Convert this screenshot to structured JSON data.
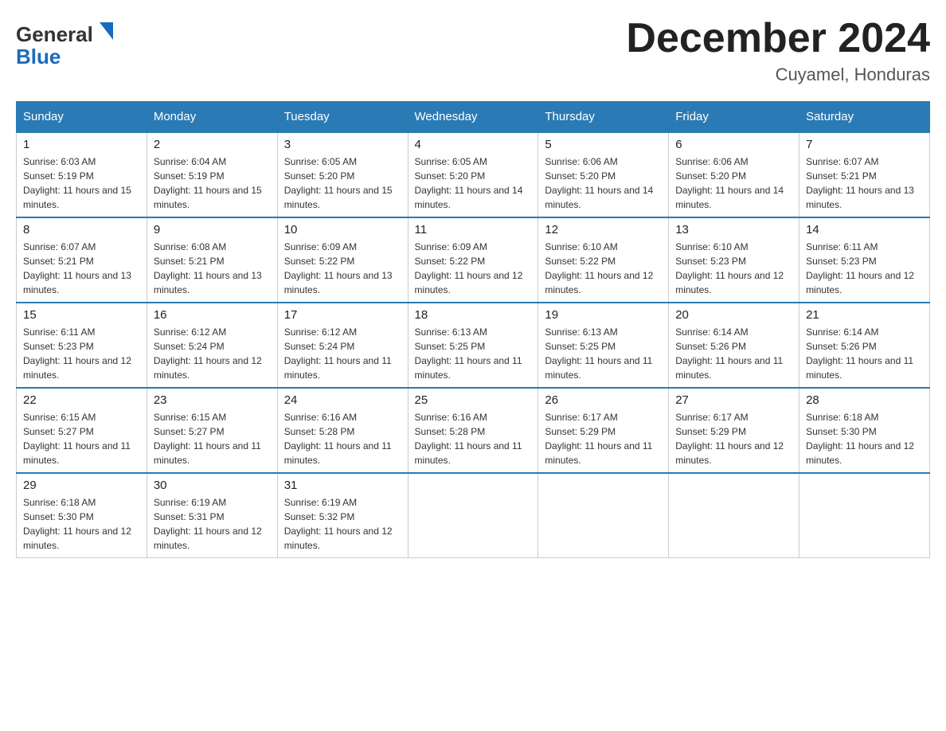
{
  "logo": {
    "line1": "General",
    "arrow": "▶",
    "line2": "Blue"
  },
  "title": "December 2024",
  "subtitle": "Cuyamel, Honduras",
  "days": [
    "Sunday",
    "Monday",
    "Tuesday",
    "Wednesday",
    "Thursday",
    "Friday",
    "Saturday"
  ],
  "weeks": [
    [
      {
        "day": "1",
        "sunrise": "6:03 AM",
        "sunset": "5:19 PM",
        "daylight": "11 hours and 15 minutes."
      },
      {
        "day": "2",
        "sunrise": "6:04 AM",
        "sunset": "5:19 PM",
        "daylight": "11 hours and 15 minutes."
      },
      {
        "day": "3",
        "sunrise": "6:05 AM",
        "sunset": "5:20 PM",
        "daylight": "11 hours and 15 minutes."
      },
      {
        "day": "4",
        "sunrise": "6:05 AM",
        "sunset": "5:20 PM",
        "daylight": "11 hours and 14 minutes."
      },
      {
        "day": "5",
        "sunrise": "6:06 AM",
        "sunset": "5:20 PM",
        "daylight": "11 hours and 14 minutes."
      },
      {
        "day": "6",
        "sunrise": "6:06 AM",
        "sunset": "5:20 PM",
        "daylight": "11 hours and 14 minutes."
      },
      {
        "day": "7",
        "sunrise": "6:07 AM",
        "sunset": "5:21 PM",
        "daylight": "11 hours and 13 minutes."
      }
    ],
    [
      {
        "day": "8",
        "sunrise": "6:07 AM",
        "sunset": "5:21 PM",
        "daylight": "11 hours and 13 minutes."
      },
      {
        "day": "9",
        "sunrise": "6:08 AM",
        "sunset": "5:21 PM",
        "daylight": "11 hours and 13 minutes."
      },
      {
        "day": "10",
        "sunrise": "6:09 AM",
        "sunset": "5:22 PM",
        "daylight": "11 hours and 13 minutes."
      },
      {
        "day": "11",
        "sunrise": "6:09 AM",
        "sunset": "5:22 PM",
        "daylight": "11 hours and 12 minutes."
      },
      {
        "day": "12",
        "sunrise": "6:10 AM",
        "sunset": "5:22 PM",
        "daylight": "11 hours and 12 minutes."
      },
      {
        "day": "13",
        "sunrise": "6:10 AM",
        "sunset": "5:23 PM",
        "daylight": "11 hours and 12 minutes."
      },
      {
        "day": "14",
        "sunrise": "6:11 AM",
        "sunset": "5:23 PM",
        "daylight": "11 hours and 12 minutes."
      }
    ],
    [
      {
        "day": "15",
        "sunrise": "6:11 AM",
        "sunset": "5:23 PM",
        "daylight": "11 hours and 12 minutes."
      },
      {
        "day": "16",
        "sunrise": "6:12 AM",
        "sunset": "5:24 PM",
        "daylight": "11 hours and 12 minutes."
      },
      {
        "day": "17",
        "sunrise": "6:12 AM",
        "sunset": "5:24 PM",
        "daylight": "11 hours and 11 minutes."
      },
      {
        "day": "18",
        "sunrise": "6:13 AM",
        "sunset": "5:25 PM",
        "daylight": "11 hours and 11 minutes."
      },
      {
        "day": "19",
        "sunrise": "6:13 AM",
        "sunset": "5:25 PM",
        "daylight": "11 hours and 11 minutes."
      },
      {
        "day": "20",
        "sunrise": "6:14 AM",
        "sunset": "5:26 PM",
        "daylight": "11 hours and 11 minutes."
      },
      {
        "day": "21",
        "sunrise": "6:14 AM",
        "sunset": "5:26 PM",
        "daylight": "11 hours and 11 minutes."
      }
    ],
    [
      {
        "day": "22",
        "sunrise": "6:15 AM",
        "sunset": "5:27 PM",
        "daylight": "11 hours and 11 minutes."
      },
      {
        "day": "23",
        "sunrise": "6:15 AM",
        "sunset": "5:27 PM",
        "daylight": "11 hours and 11 minutes."
      },
      {
        "day": "24",
        "sunrise": "6:16 AM",
        "sunset": "5:28 PM",
        "daylight": "11 hours and 11 minutes."
      },
      {
        "day": "25",
        "sunrise": "6:16 AM",
        "sunset": "5:28 PM",
        "daylight": "11 hours and 11 minutes."
      },
      {
        "day": "26",
        "sunrise": "6:17 AM",
        "sunset": "5:29 PM",
        "daylight": "11 hours and 11 minutes."
      },
      {
        "day": "27",
        "sunrise": "6:17 AM",
        "sunset": "5:29 PM",
        "daylight": "11 hours and 12 minutes."
      },
      {
        "day": "28",
        "sunrise": "6:18 AM",
        "sunset": "5:30 PM",
        "daylight": "11 hours and 12 minutes."
      }
    ],
    [
      {
        "day": "29",
        "sunrise": "6:18 AM",
        "sunset": "5:30 PM",
        "daylight": "11 hours and 12 minutes."
      },
      {
        "day": "30",
        "sunrise": "6:19 AM",
        "sunset": "5:31 PM",
        "daylight": "11 hours and 12 minutes."
      },
      {
        "day": "31",
        "sunrise": "6:19 AM",
        "sunset": "5:32 PM",
        "daylight": "11 hours and 12 minutes."
      },
      null,
      null,
      null,
      null
    ]
  ],
  "labels": {
    "sunrise": "Sunrise:",
    "sunset": "Sunset:",
    "daylight": "Daylight:"
  }
}
